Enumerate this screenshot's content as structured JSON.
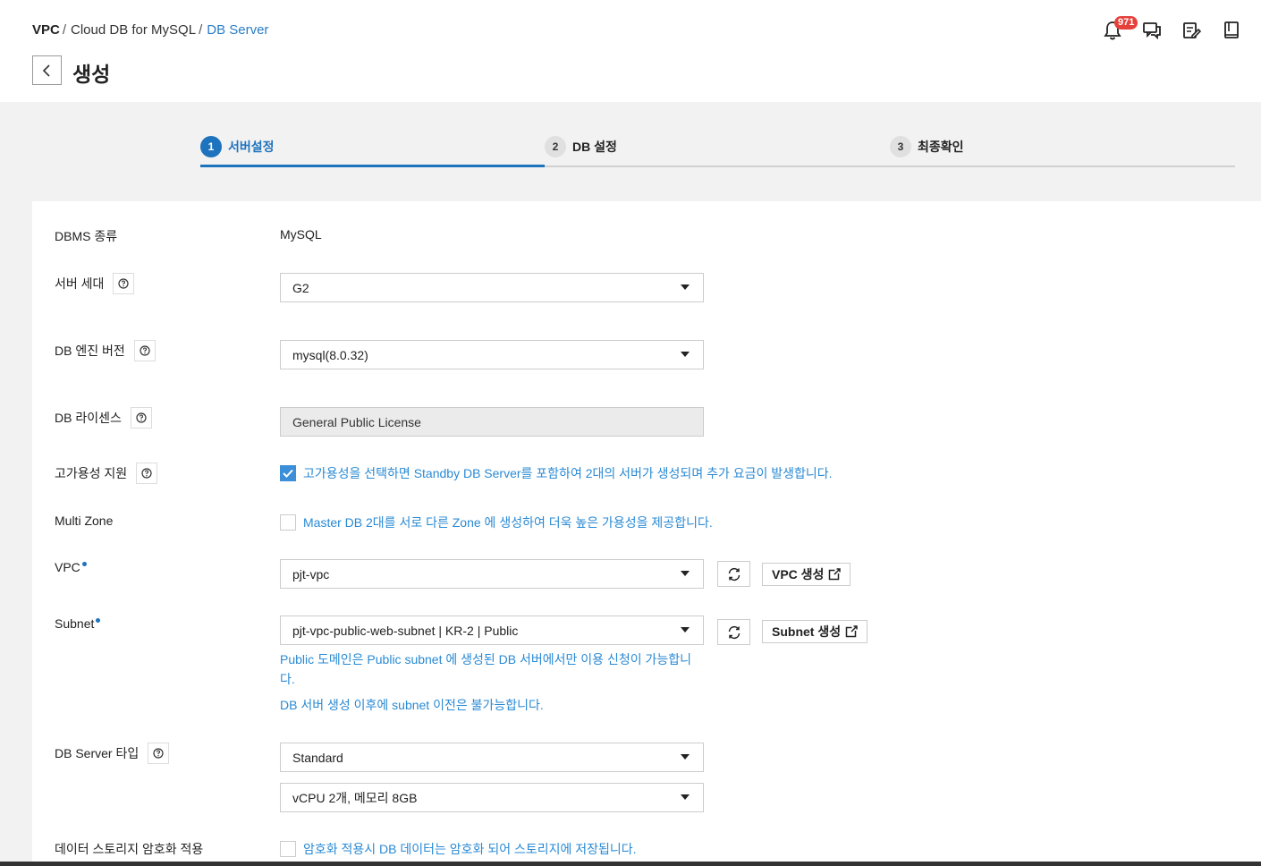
{
  "breadcrumb": {
    "item1": "VPC",
    "item2": "Cloud DB for MySQL",
    "item3": "DB Server",
    "sep": "/"
  },
  "page": {
    "title": "생성"
  },
  "notifications": {
    "count": "971"
  },
  "steps": [
    {
      "num": "1",
      "label": "서버설정"
    },
    {
      "num": "2",
      "label": "DB 설정"
    },
    {
      "num": "3",
      "label": "최종확인"
    }
  ],
  "form": {
    "dbms": {
      "label": "DBMS 종류",
      "value": "MySQL"
    },
    "generation": {
      "label": "서버 세대",
      "value": "G2"
    },
    "engine": {
      "label": "DB 엔진 버전",
      "value": "mysql(8.0.32)"
    },
    "license": {
      "label": "DB 라이센스",
      "value": "General Public License"
    },
    "ha": {
      "label": "고가용성 지원",
      "text": "고가용성을 선택하면 Standby DB Server를 포함하여 2대의 서버가 생성되며 추가 요금이 발생합니다."
    },
    "multizone": {
      "label": "Multi Zone",
      "text": "Master DB 2대를 서로 다른 Zone 에 생성하여 더욱 높은 가용성을 제공합니다."
    },
    "vpc": {
      "label": "VPC",
      "value": "pjt-vpc",
      "create_label": "VPC 생성"
    },
    "subnet": {
      "label": "Subnet",
      "value": "pjt-vpc-public-web-subnet | KR-2 | Public",
      "create_label": "Subnet 생성",
      "info1": "Public 도메인은 Public subnet 에 생성된 DB 서버에서만 이용 신청이 가능합니다.",
      "info2": "DB 서버 생성 이후에 subnet 이전은 불가능합니다."
    },
    "server_type": {
      "label": "DB Server 타입",
      "value": "Standard",
      "spec": "vCPU 2개, 메모리 8GB"
    },
    "encryption": {
      "label": "데이터 스토리지 암호화 적용",
      "text": "암호화 적용시 DB 데이터는 암호화 되어 스토리지에 저장됩니다."
    }
  }
}
